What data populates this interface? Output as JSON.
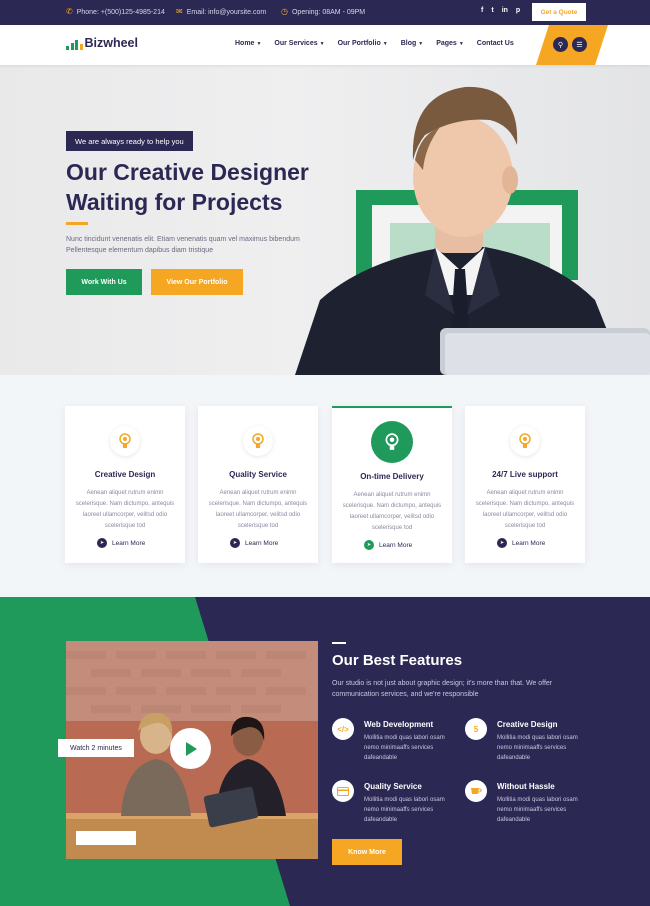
{
  "topbar": {
    "phone": "Phone: +(500)125-4985-214",
    "email": "Email: info@yoursite.com",
    "hours": "Opening: 08AM - 09PM",
    "social": [
      "f",
      "t",
      "in",
      "p"
    ],
    "quote_button": "Get a Quote"
  },
  "header": {
    "logo": "Bizwheel",
    "nav": [
      {
        "label": "Home",
        "dropdown": true
      },
      {
        "label": "Our Services",
        "dropdown": true
      },
      {
        "label": "Our Portfolio",
        "dropdown": true
      },
      {
        "label": "Blog",
        "dropdown": true
      },
      {
        "label": "Pages",
        "dropdown": true
      },
      {
        "label": "Contact Us",
        "dropdown": false
      }
    ]
  },
  "hero": {
    "tagline": "We are always ready to help you",
    "title_line1": "Our Creative Designer",
    "title_line2": "Waiting for Projects",
    "description": "Nunc tincidunt venenatis elit. Etiam venenatis quam vel maximus bibendum Pellentesque elementum dapibus diam tristique",
    "primary_button": "Work With Us",
    "secondary_button": "View Our Portfolio"
  },
  "services": [
    {
      "title": "Creative Design",
      "text": "Aenean aliquet rutrum enimn scelerisque. Nam dictumpo, antequis laoreet ullamcorper, velitsd odio scelerisque tod",
      "more": "Learn More",
      "active": false
    },
    {
      "title": "Quality Service",
      "text": "Aenean aliquet rutrum enimn scelerisque. Nam dictumpo, antequis laoreet ullamcorper, velitsd odio scelerisque tod",
      "more": "Learn More",
      "active": false
    },
    {
      "title": "On-time Delivery",
      "text": "Aenean aliquet rutrum enimn scelerisque. Nam dictumpo, antequis laoreet ullamcorper, velitsd odio scelerisque tod",
      "more": "Learn More",
      "active": true
    },
    {
      "title": "24/7 Live support",
      "text": "Aenean aliquet rutrum enimn scelerisque. Nam dictumpo, antequis laoreet ullamcorper, velitsd odio scelerisque tod",
      "more": "Learn More",
      "active": false
    }
  ],
  "features": {
    "video_label": "Watch 2 minutes",
    "title": "Our Best Features",
    "description": "Our studio is not just about graphic design; it's more than that. We offer communication services, and we're responsible",
    "items": [
      {
        "title": "Web Development",
        "text": "Mollitia modi quas labori osam nemo minimaaffs services dafeandable",
        "icon": "code-icon"
      },
      {
        "title": "Creative Design",
        "text": "Mollitia modi quas labori osam nemo minimaaffs services dafeandable",
        "icon": "html-icon"
      },
      {
        "title": "Quality Service",
        "text": "Mollitia modi quas labori osam nemo minimaaffs services dafeandable",
        "icon": "card-icon"
      },
      {
        "title": "Without Hassle",
        "text": "Mollitia modi quas labori osam nemo minimaaffs services dafeandable",
        "icon": "coffee-icon"
      }
    ],
    "button": "Know More"
  },
  "colors": {
    "navy": "#2c2854",
    "green": "#1f9a5a",
    "orange": "#f5a623"
  }
}
